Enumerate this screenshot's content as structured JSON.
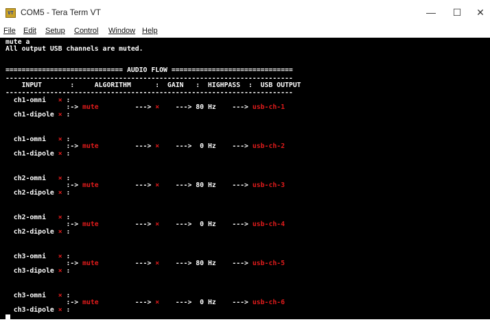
{
  "window": {
    "title": "COM5 - Tera Term VT",
    "icon_label": "VT",
    "controls": {
      "minimize": "—",
      "maximize": "☐",
      "close": "✕"
    }
  },
  "menu": [
    "File",
    "Edit",
    "Setup",
    "Control",
    "Window",
    "Help"
  ],
  "terminal": {
    "command": "mute a",
    "response": "All output USB channels are muted.",
    "flow_header": "============================= AUDIO FLOW ==============================",
    "column_header": "    INPUT       :     ALGORITHM      :  GAIN   :  HIGHPASS  :  USB OUTPUT",
    "separator": "-----------------------------------------------------------------------",
    "colors": {
      "background": "#000000",
      "text": "#ffffff",
      "muted": "#e01b1b"
    },
    "channels": [
      {
        "omni": "ch1-omni",
        "dipole": "ch1-dipole",
        "algorithm": "mute",
        "gain": "×",
        "highpass": "80 Hz",
        "output": "usb-ch-1"
      },
      {
        "omni": "ch1-omni",
        "dipole": "ch1-dipole",
        "algorithm": "mute",
        "gain": "×",
        "highpass": " 0 Hz",
        "output": "usb-ch-2"
      },
      {
        "omni": "ch2-omni",
        "dipole": "ch2-dipole",
        "algorithm": "mute",
        "gain": "×",
        "highpass": "80 Hz",
        "output": "usb-ch-3"
      },
      {
        "omni": "ch2-omni",
        "dipole": "ch2-dipole",
        "algorithm": "mute",
        "gain": "×",
        "highpass": " 0 Hz",
        "output": "usb-ch-4"
      },
      {
        "omni": "ch3-omni",
        "dipole": "ch3-dipole",
        "algorithm": "mute",
        "gain": "×",
        "highpass": "80 Hz",
        "output": "usb-ch-5"
      },
      {
        "omni": "ch3-omni",
        "dipole": "ch3-dipole",
        "algorithm": "mute",
        "gain": "×",
        "highpass": " 0 Hz",
        "output": "usb-ch-6"
      }
    ]
  }
}
